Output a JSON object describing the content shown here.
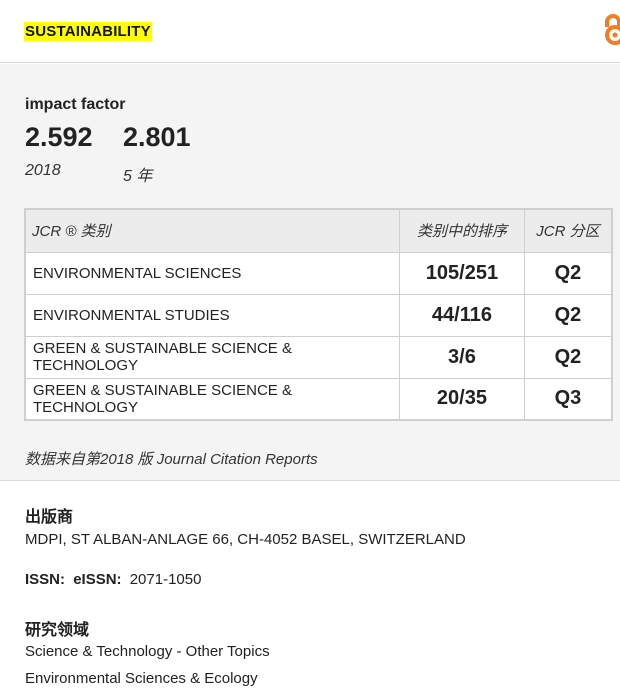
{
  "header": {
    "journal_title": "SUSTAINABILITY",
    "open_access_icon": "open-access-icon",
    "accent_color": "#f47c20",
    "highlight_color": "#ffff00"
  },
  "impact": {
    "label": "impact factor",
    "values": [
      {
        "value": "2.592",
        "period": "2018"
      },
      {
        "value": "2.801",
        "period": "5 年"
      }
    ]
  },
  "jcr": {
    "headers": [
      "JCR ® 类别",
      "类别中的排序",
      "JCR 分区"
    ],
    "rows": [
      {
        "category": "ENVIRONMENTAL SCIENCES",
        "rank": "105/251",
        "quartile": "Q2"
      },
      {
        "category": "ENVIRONMENTAL STUDIES",
        "rank": "44/116",
        "quartile": "Q2"
      },
      {
        "category": "GREEN & SUSTAINABLE SCIENCE & TECHNOLOGY",
        "rank": "3/6",
        "quartile": "Q2"
      },
      {
        "category": "GREEN & SUSTAINABLE SCIENCE & TECHNOLOGY",
        "rank": "20/35",
        "quartile": "Q3"
      }
    ],
    "source": "数据来自第2018 版 Journal Citation Reports"
  },
  "publisher": {
    "title": "出版商",
    "address": "MDPI, ST ALBAN-ANLAGE 66, CH-4052 BASEL, SWITZERLAND"
  },
  "issn": {
    "issn_label": "ISSN:",
    "eissn_label": "eISSN:",
    "eissn_value": "2071-1050"
  },
  "research": {
    "title": "研究领域",
    "areas": [
      "Science & Technology - Other Topics",
      "Environmental Sciences & Ecology"
    ]
  }
}
